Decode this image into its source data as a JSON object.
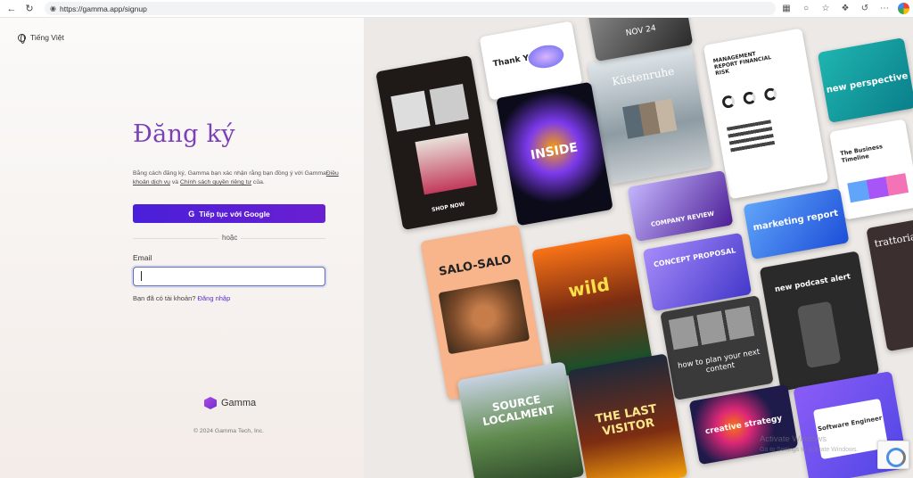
{
  "browser": {
    "url": "https://gamma.app/signup"
  },
  "page": {
    "language": "Tiếng Việt",
    "title": "Đăng ký",
    "terms_prefix": "Bằng cách đăng ký, Gamma bạn xác nhận rằng bạn đồng ý với Gamma",
    "terms_link": "Điều khoản dịch vụ",
    "terms_and": " và ",
    "privacy_link": "Chính sách quyền riêng tư",
    "terms_suffix": " của.",
    "google_button": "Tiếp tục với Google",
    "or_text": "hoặc",
    "email_label": "Email",
    "email_value": "",
    "signin_prompt": "Bạn đã có tài khoản? ",
    "signin_link": "Đăng nhập",
    "brand_name": "Gamma",
    "copyright": "© 2024 Gamma Tech, Inc."
  },
  "mosaic": {
    "cards": [
      {
        "text": "Thank You!"
      },
      {
        "text": "Küstenruhe"
      },
      {
        "text": "MANAGEMENT REPORT FINANCIAL RISK"
      },
      {
        "text": "new perspective"
      },
      {
        "text": "INSIDE"
      },
      {
        "text": "SHOP NOW"
      },
      {
        "text": "COMPANY REVIEW"
      },
      {
        "text": "The Business Timeline"
      },
      {
        "text": "marketing report"
      },
      {
        "text": "SALO-SALO"
      },
      {
        "text": "wild"
      },
      {
        "text": "CONCEPT PROPOSAL"
      },
      {
        "text": "new podcast alert"
      },
      {
        "text": "trattoria"
      },
      {
        "text": "how to plan your next content"
      },
      {
        "text": "SOURCE LOCALMENT"
      },
      {
        "text": "THE LAST VISITOR"
      },
      {
        "text": "creative strategy"
      },
      {
        "text": "Software Engineer"
      },
      {
        "text": "NOV 24"
      }
    ]
  },
  "overlay": {
    "activate_title": "Activate Windows",
    "activate_sub": "Go to Settings to activate Windows."
  }
}
